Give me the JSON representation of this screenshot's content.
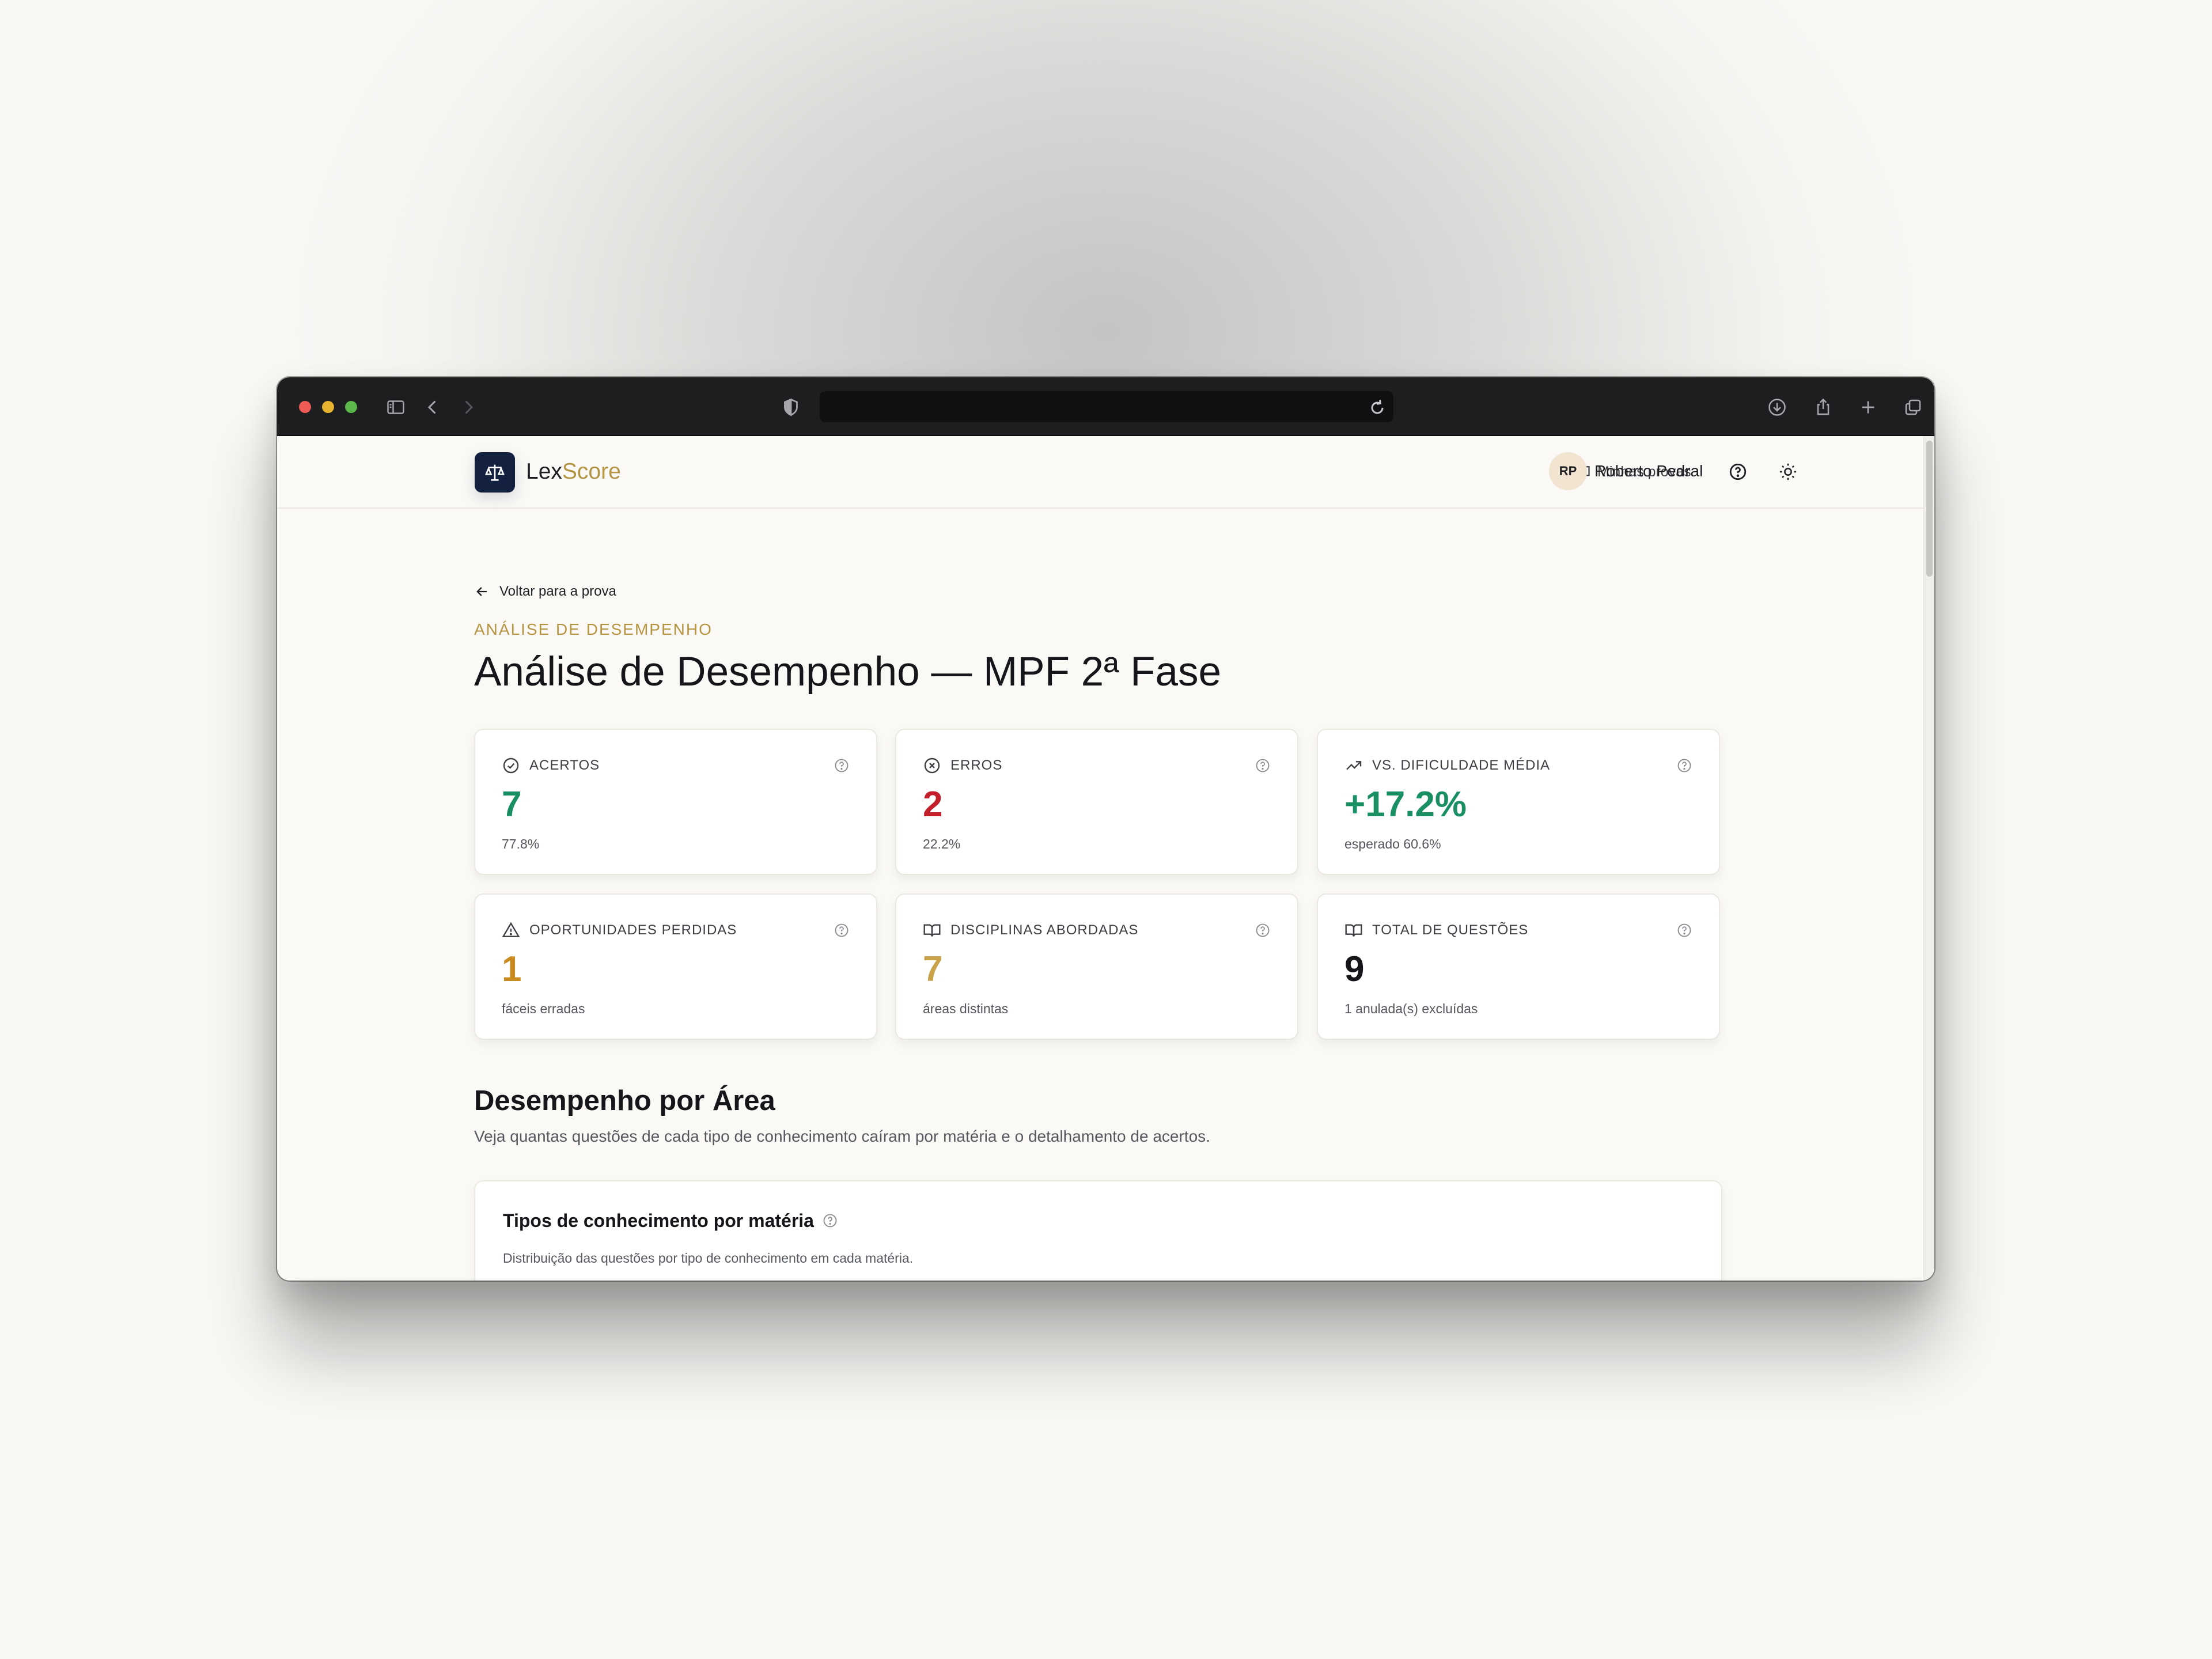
{
  "colors": {
    "navy": "#13203f",
    "gold": "#b39443",
    "green": "#1a8f63",
    "red": "#c3202b",
    "orange": "#c98a1f",
    "ink": "#15161a"
  },
  "browser": {
    "url": "",
    "icons": [
      "sidebar-icon",
      "back-icon",
      "forward-icon",
      "shield-icon",
      "reload-icon",
      "download-icon",
      "share-icon",
      "new-tab-icon",
      "tabs-overview-icon"
    ]
  },
  "header": {
    "brand_part1": "Lex",
    "brand_part2": "Score",
    "nav_my_exams": "Minhas provas",
    "avatar_initials": "RP",
    "user_name": "Roberto Pedral"
  },
  "main": {
    "back_link": "Voltar para a prova",
    "eyebrow": "ANÁLISE DE DESEMPENHO",
    "title": "Análise de Desempenho — MPF 2ª Fase",
    "cards": [
      {
        "label": "ACERTOS",
        "value": "7",
        "sub": "77.8%",
        "icon": "check-circle-icon",
        "color": "#1a8f63"
      },
      {
        "label": "ERROS",
        "value": "2",
        "sub": "22.2%",
        "icon": "x-circle-icon",
        "color": "#c3202b"
      },
      {
        "label": "VS. DIFICULDADE MÉDIA",
        "value": "+17.2%",
        "sub": "esperado 60.6%",
        "icon": "trending-up-icon",
        "color": "#1a8f63"
      },
      {
        "label": "OPORTUNIDADES PERDIDAS",
        "value": "1",
        "sub": "fáceis erradas",
        "icon": "warning-triangle-icon",
        "color": "#c98a1f"
      },
      {
        "label": "DISCIPLINAS ABORDADAS",
        "value": "7",
        "sub": "áreas distintas",
        "icon": "book-icon",
        "color": "#c9a24a"
      },
      {
        "label": "TOTAL DE QUESTÕES",
        "value": "9",
        "sub": "1 anulada(s) excluídas",
        "icon": "book-icon",
        "color": "#15161a"
      }
    ],
    "section_title": "Desempenho por Área",
    "section_desc": "Veja quantas questões de cada tipo de conhecimento caíram por matéria e o detalhamento de acertos.",
    "panel_title": "Tipos de conhecimento por matéria",
    "panel_desc": "Distribuição das questões por tipo de conhecimento em cada matéria."
  }
}
